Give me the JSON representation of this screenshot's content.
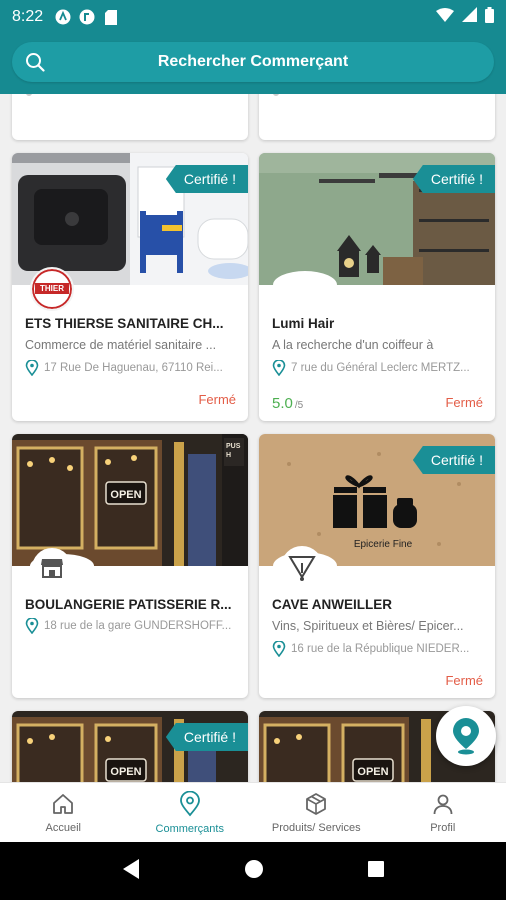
{
  "status_bar": {
    "time": "8:22"
  },
  "search": {
    "placeholder": "Rechercher Commerçant"
  },
  "cards": [
    {
      "name": "ETS THIERSE SANITAIRE CH...",
      "description": "Commerce de matériel sanitaire ...",
      "address": "17 Rue De Haguenau, 67110 Rei...",
      "badge": "Certifié !",
      "status": "Fermé",
      "logo_text": "THIER"
    },
    {
      "name": "Lumi Hair",
      "description": "A la recherche d'un coiffeur à",
      "address": "7 rue du Général Leclerc MERTZ...",
      "badge": "Certifié !",
      "status": "Fermé",
      "rating": "5.0",
      "rating_max": "/5"
    },
    {
      "name": "BOULANGERIE PATISSERIE R...",
      "address": "18 rue de la gare GUNDERSHOFF...",
      "shop_sign": "OPEN",
      "push_sign": "PUSH"
    },
    {
      "name": "CAVE ANWEILLER",
      "description": "Vins, Spiritueux et Bières/ Epicer...",
      "address": "16 rue de la République NIEDER...",
      "badge": "Certifié !",
      "status": "Fermé",
      "image_caption": "Epicerie Fine"
    },
    {
      "badge": "Certifié !",
      "shop_sign": "OPEN"
    },
    {
      "shop_sign": "OPEN"
    }
  ],
  "bottom_nav": [
    {
      "label": "Accueil",
      "icon": "home-icon",
      "active": false
    },
    {
      "label": "Commerçants",
      "icon": "location-pin-icon",
      "active": true
    },
    {
      "label": "Produits/ Services",
      "icon": "box-icon",
      "active": false
    },
    {
      "label": "Profil",
      "icon": "person-icon",
      "active": false
    }
  ],
  "colors": {
    "primary": "#168a91",
    "accent": "#1a8f96",
    "closed": "#e35d47",
    "rating": "#4caf50"
  }
}
